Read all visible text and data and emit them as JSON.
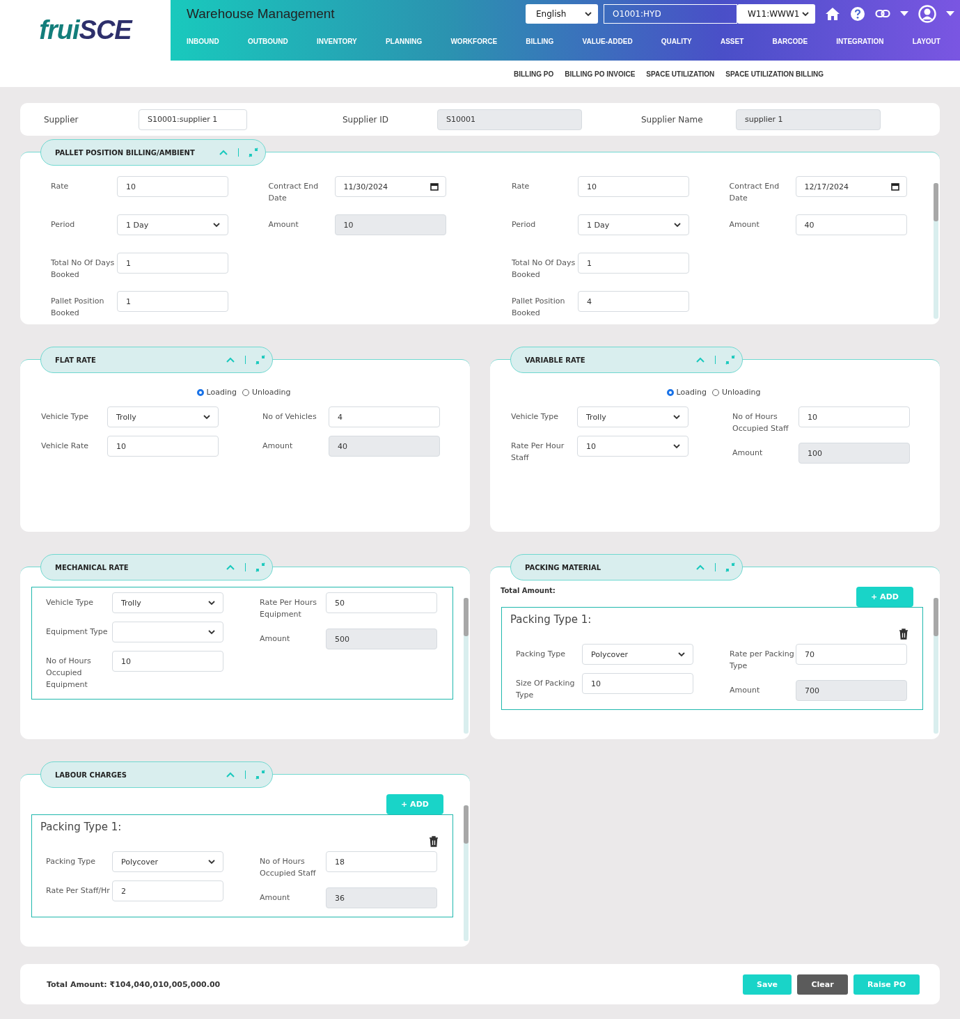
{
  "header": {
    "logo_parts": [
      "frui",
      "SCE"
    ],
    "app_title": "Warehouse Management",
    "language": "English",
    "organization": "O1001:HYD",
    "warehouse": "W11:WWW1",
    "nav": [
      {
        "label": "INBOUND"
      },
      {
        "label": "OUTBOUND"
      },
      {
        "label": "INVENTORY"
      },
      {
        "label": "PLANNING"
      },
      {
        "label": "WORKFORCE"
      },
      {
        "label": "BILLING"
      },
      {
        "label": "VALUE-ADDED"
      },
      {
        "label": "QUALITY"
      },
      {
        "label": "ASSET"
      },
      {
        "label": "BARCODE"
      },
      {
        "label": "INTEGRATION"
      },
      {
        "label": "LAYOUT"
      }
    ],
    "subnav": [
      {
        "label": "BILLING PO"
      },
      {
        "label": "BILLING PO INVOICE"
      },
      {
        "label": "SPACE UTILIZATION"
      },
      {
        "label": "SPACE UTILIZATION BILLING"
      }
    ]
  },
  "supplier_bar": {
    "fields": [
      {
        "label": "Supplier",
        "value": "S10001:supplier 1",
        "kind": "text",
        "readonly": false
      },
      {
        "label": "Supplier ID",
        "value": "S10001",
        "kind": "text",
        "readonly": true
      },
      {
        "label": "Supplier Name",
        "value": "supplier 1",
        "kind": "text",
        "readonly": true
      }
    ]
  },
  "sections": [
    {
      "title": "PALLET POSITION BILLING/AMBIENT",
      "kind": "full",
      "scrollable": true,
      "groups": [
        {
          "columns": [
            [
              {
                "label": "Rate",
                "value": "10",
                "kind": "text",
                "readonly": false
              },
              {
                "label": "Period",
                "value": "1 Day",
                "kind": "select",
                "readonly": false
              },
              {
                "label": "Total No Of Days Booked",
                "value": "1",
                "kind": "text",
                "readonly": false
              },
              {
                "label": "Pallet Position Booked",
                "value": "1",
                "kind": "text",
                "readonly": false
              }
            ],
            [
              {
                "label": "Contract End Date",
                "value": "11/30/2024",
                "kind": "date",
                "readonly": false
              },
              {
                "label": "Amount",
                "value": "10",
                "kind": "text",
                "readonly": true
              }
            ]
          ]
        },
        {
          "columns": [
            [
              {
                "label": "Rate",
                "value": "10",
                "kind": "text",
                "readonly": false
              },
              {
                "label": "Period",
                "value": "1 Day",
                "kind": "select",
                "readonly": false
              },
              {
                "label": "Total No Of Days Booked",
                "value": "1",
                "kind": "text",
                "readonly": false
              },
              {
                "label": "Pallet Position Booked",
                "value": "4",
                "kind": "text",
                "readonly": false
              }
            ],
            [
              {
                "label": "Contract End Date",
                "value": "12/17/2024",
                "kind": "date",
                "readonly": false
              },
              {
                "label": "Amount",
                "value": "40",
                "kind": "text",
                "readonly": false
              }
            ]
          ]
        }
      ]
    },
    {
      "title": "FLAT RATE",
      "kind": "half",
      "radios": [
        {
          "label": "Loading",
          "selected": true
        },
        {
          "label": "Unloading",
          "selected": false
        }
      ],
      "groups": [
        {
          "columns": [
            [
              {
                "label": "Vehicle Type",
                "value": "Trolly",
                "kind": "select",
                "readonly": false
              },
              {
                "label": "Vehicle Rate",
                "value": "10",
                "kind": "text",
                "readonly": false
              }
            ],
            [
              {
                "label": "No of Vehicles",
                "value": "4",
                "kind": "text",
                "readonly": false
              },
              {
                "label": "Amount",
                "value": "40",
                "kind": "text",
                "readonly": true
              }
            ]
          ]
        }
      ]
    },
    {
      "title": "VARIABLE RATE",
      "kind": "half",
      "radios": [
        {
          "label": "Loading",
          "selected": true
        },
        {
          "label": "Unloading",
          "selected": false
        }
      ],
      "groups": [
        {
          "columns": [
            [
              {
                "label": "Vehicle Type",
                "value": "Trolly",
                "kind": "select",
                "readonly": false
              },
              {
                "label": "Rate Per Hour Staff",
                "value": "10",
                "kind": "select",
                "readonly": false
              }
            ],
            [
              {
                "label": "No of Hours Occupied Staff",
                "value": "10",
                "kind": "text",
                "readonly": false
              },
              {
                "label": "Amount",
                "value": "100",
                "kind": "text",
                "readonly": true
              }
            ]
          ]
        }
      ]
    },
    {
      "title": "MECHANICAL RATE",
      "kind": "half",
      "scrollable": true,
      "groups": [
        {
          "boxed": true,
          "columns": [
            [
              {
                "label": "Vehicle Type",
                "value": "Trolly",
                "kind": "select",
                "readonly": false
              },
              {
                "label": "Equipment Type",
                "kind": "select",
                "readonly": false
              },
              {
                "label": "No of Hours Occupied Equipment",
                "value": "10",
                "kind": "text",
                "readonly": false
              }
            ],
            [
              {
                "label": "Rate Per Hours Equipment",
                "value": "50",
                "kind": "text",
                "readonly": false
              },
              {
                "label": "Amount",
                "value": "500",
                "kind": "text",
                "readonly": true
              }
            ]
          ]
        }
      ]
    },
    {
      "title": "PACKING MATERIAL",
      "kind": "half",
      "scrollable": true,
      "total_label": "Total Amount:",
      "add_button": "+ ADD",
      "groups": [
        {
          "boxed": true,
          "title": "Packing Type 1:",
          "deletable": true,
          "columns": [
            [
              {
                "label": "Packing Type",
                "value": "Polycover",
                "kind": "select",
                "readonly": false
              },
              {
                "label": "Size Of Packing Type",
                "value": "10",
                "kind": "text",
                "readonly": false
              }
            ],
            [
              {
                "label": "Rate per Packing Type",
                "value": "70",
                "kind": "text",
                "readonly": false
              },
              {
                "label": "Amount",
                "value": "700",
                "kind": "text",
                "readonly": true
              }
            ]
          ]
        }
      ]
    },
    {
      "title": "LABOUR CHARGES",
      "kind": "half",
      "scrollable": true,
      "add_button": "+ ADD",
      "groups": [
        {
          "boxed": true,
          "title": "Packing Type 1:",
          "deletable": true,
          "columns": [
            [
              {
                "label": "Packing Type",
                "value": "Polycover",
                "kind": "select",
                "readonly": false
              },
              {
                "label": "Rate Per Staff/Hr",
                "value": "2",
                "kind": "text",
                "readonly": false
              }
            ],
            [
              {
                "label": "No of Hours Occupied Staff",
                "value": "18",
                "kind": "text",
                "readonly": false
              },
              {
                "label": "Amount",
                "value": "36",
                "kind": "text",
                "readonly": true
              }
            ]
          ]
        }
      ]
    }
  ],
  "footer": {
    "total": "Total Amount: ₹104,040,010,005,000.00",
    "buttons": [
      {
        "label": "Save",
        "kind": "primary"
      },
      {
        "label": "Clear",
        "kind": "secondary"
      },
      {
        "label": "Raise PO",
        "kind": "primary"
      }
    ]
  }
}
